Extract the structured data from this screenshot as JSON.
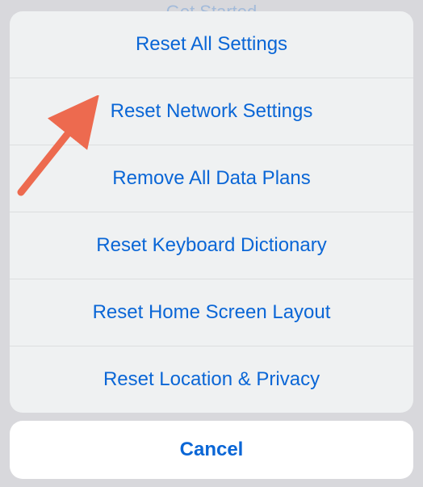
{
  "backdrop": {
    "title": "Get Started"
  },
  "sheet": {
    "items": [
      "Reset All Settings",
      "Reset Network Settings",
      "Remove All Data Plans",
      "Reset Keyboard Dictionary",
      "Reset Home Screen Layout",
      "Reset Location & Privacy"
    ],
    "cancel": "Cancel"
  },
  "colors": {
    "accent": "#0a66d6",
    "arrow": "#ed6a4f"
  }
}
